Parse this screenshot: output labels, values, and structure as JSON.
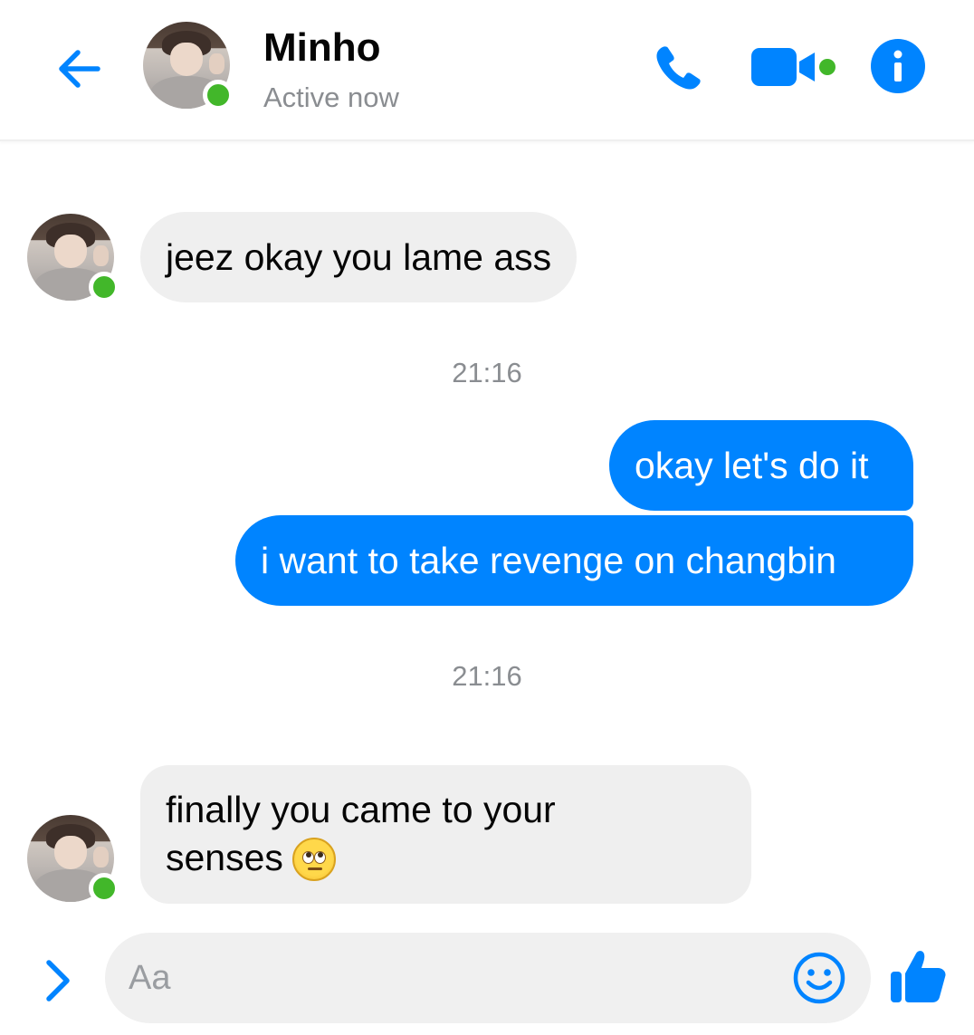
{
  "header": {
    "back_icon": "arrow-left-icon",
    "contact_name": "Minho",
    "status": "Active now",
    "actions": [
      {
        "icon": "phone-icon",
        "label": "Voice call"
      },
      {
        "icon": "video-camera-icon",
        "label": "Video call"
      },
      {
        "icon": "info-icon",
        "label": "Info"
      }
    ]
  },
  "colors": {
    "accent": "#0084ff",
    "online": "#42b72a",
    "incoming_bubble": "#efefef",
    "muted_text": "#8a8d91"
  },
  "messages": [
    {
      "direction": "incoming",
      "text": "jeez okay you lame ass"
    },
    {
      "type": "timestamp",
      "text": "21:16"
    },
    {
      "direction": "outgoing",
      "text": "okay let's do it"
    },
    {
      "direction": "outgoing",
      "text": "i want to take revenge on changbin"
    },
    {
      "type": "timestamp",
      "text": "21:16"
    },
    {
      "direction": "incoming",
      "text_line1": "finally you came to your",
      "text_line2": "senses",
      "emoji": "face-with-rolling-eyes-icon"
    }
  ],
  "composer": {
    "expand_icon": "chevron-right-icon",
    "placeholder": "Aa",
    "value": "",
    "emoji_icon": "smiley-icon",
    "like_icon": "thumbs-up-icon"
  }
}
